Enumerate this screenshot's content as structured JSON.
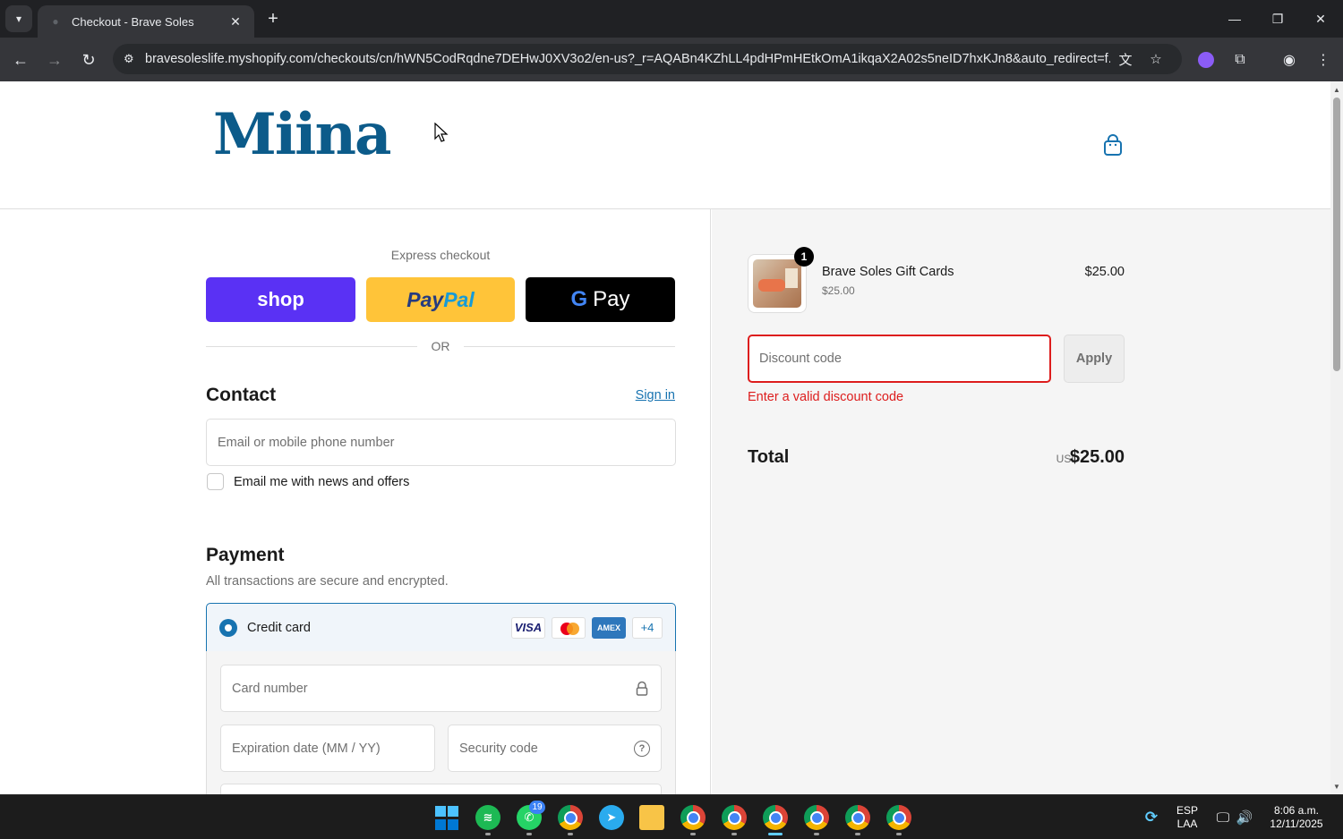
{
  "browser": {
    "tab_title": "Checkout - Brave Soles",
    "url": "bravesoleslife.myshopify.com/checkouts/cn/hWN5CodRqdne7DEHwJ0XV3o2/en-us?_r=AQABn4KZhLL4pdHPmHEtkOmA1ikqaX2A02s5neID7hxKJn8&auto_redirect=f..."
  },
  "header": {
    "logo_text": "Miina"
  },
  "express": {
    "label": "Express checkout",
    "shop_label": "shop",
    "paypal_part1": "Pay",
    "paypal_part2": "Pal",
    "gpay_g": "G",
    "gpay_label": "Pay",
    "or_label": "OR"
  },
  "contact": {
    "title": "Contact",
    "sign_in": "Sign in",
    "email_placeholder": "Email or mobile phone number",
    "news_label": "Email me with news and offers"
  },
  "payment": {
    "title": "Payment",
    "subtitle": "All transactions are secure and encrypted.",
    "method_label": "Credit card",
    "badges": {
      "visa": "VISA",
      "amex": "AMEX",
      "more": "+4"
    },
    "card_number_placeholder": "Card number",
    "expiry_placeholder": "Expiration date (MM / YY)",
    "security_placeholder": "Security code"
  },
  "summary": {
    "item": {
      "quantity": "1",
      "name": "Brave Soles Gift Cards",
      "variant_price": "$25.00",
      "price": "$25.00"
    },
    "discount_placeholder": "Discount code",
    "apply_label": "Apply",
    "error": "Enter a valid discount code",
    "total_label": "Total",
    "currency": "USD",
    "total_value": "$25.00"
  },
  "taskbar": {
    "whatsapp_badge": "19",
    "lang_top": "ESP",
    "lang_bottom": "LAA",
    "time": "8:06 a.m.",
    "date": "12/11/2025"
  },
  "colors": {
    "accent": "#1773b0",
    "error": "#dd1d1d",
    "shop": "#5a31f4",
    "paypal": "#ffc439",
    "logo": "#0c5b8a"
  }
}
